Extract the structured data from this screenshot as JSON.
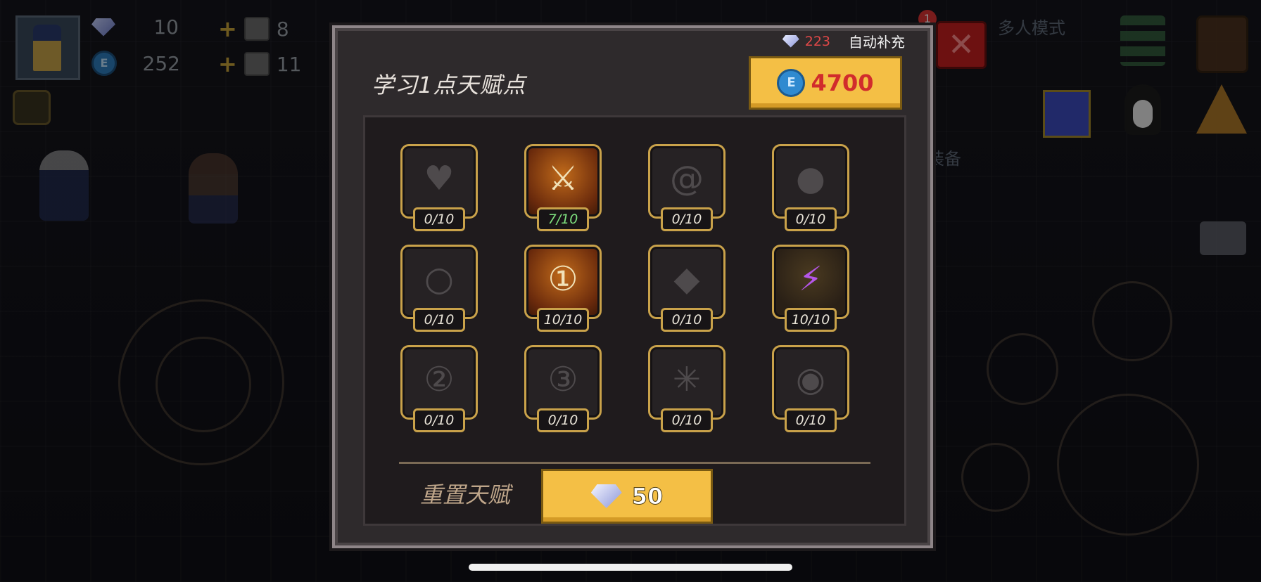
{
  "hud": {
    "gems": "10",
    "coins": "252",
    "item_a": "8",
    "item_b": "11",
    "notification_badge": "1",
    "side_text_top": "多人模式",
    "side_text_mid": "装备"
  },
  "panel": {
    "title": "学习1点天赋点",
    "autofill_gems": "223",
    "autofill_label": "自动补充",
    "cost_value": "4700",
    "cost_currency_icon": "coin-icon",
    "reset_label": "重置天赋",
    "reset_cost": "50",
    "reset_currency_icon": "gem-icon"
  },
  "talents": [
    {
      "icon": "heart-icon",
      "level": "0/10"
    },
    {
      "icon": "sword-icon",
      "level": "7/10"
    },
    {
      "icon": "swirl-icon",
      "level": "0/10"
    },
    {
      "icon": "drop-icon",
      "level": "0/10"
    },
    {
      "icon": "bubble-icon",
      "level": "0/10"
    },
    {
      "icon": "ring-1-icon",
      "level": "10/10"
    },
    {
      "icon": "diamond-icon",
      "level": "0/10"
    },
    {
      "icon": "lightning-icon",
      "level": "10/10"
    },
    {
      "icon": "ring-2-icon",
      "level": "0/10"
    },
    {
      "icon": "ring-3-icon",
      "level": "0/10"
    },
    {
      "icon": "spark-icon",
      "level": "0/10"
    },
    {
      "icon": "eye-icon",
      "level": "0/10"
    }
  ],
  "colors": {
    "accent_gold": "#f4bf45",
    "cost_red": "#d12c2c",
    "partial_green": "#7ee07e",
    "panel_bg": "#2e2a2c"
  }
}
